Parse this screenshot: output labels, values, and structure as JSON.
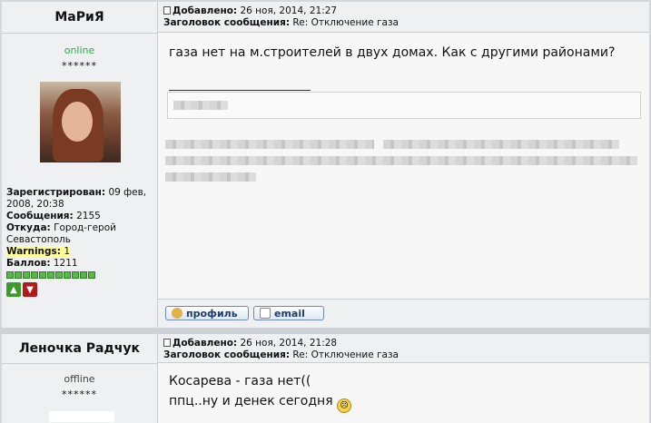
{
  "posts": [
    {
      "author": "МаРиЯ",
      "status": "online",
      "status_color": "#2eaa4a",
      "stars": "******",
      "meta": {
        "added_label": "Добавлено:",
        "added_value": "26 ноя, 2014, 21:27",
        "subject_label": "Заголовок сообщения:",
        "subject_value": "Re: Отключение газа"
      },
      "info": {
        "registered_label": "Зарегистрирован:",
        "registered_value": "09 фев, 2008, 20:38",
        "messages_label": "Сообщения:",
        "messages_value": "2155",
        "from_label": "Откуда:",
        "from_value": "Город-герой Севастополь",
        "warnings_label": "Warnings:",
        "warnings_value": "1",
        "points_label": "Баллов:",
        "points_value": "1211"
      },
      "rating_dots": 11,
      "text": "газа нет на м.строителей в двух домах. Как с другими районами?",
      "buttons": {
        "profile": "профиль",
        "email": "email"
      }
    },
    {
      "author": "Леночка Радчук",
      "status": "offline",
      "stars": "******",
      "meta": {
        "added_label": "Добавлено:",
        "added_value": "26 ноя, 2014, 21:28",
        "subject_label": "Заголовок сообщения:",
        "subject_value": "Re: Отключение газа"
      },
      "text_line1": "Косарева - газа нет((",
      "text_line2": "ппц..ну и денек сегодня"
    }
  ]
}
